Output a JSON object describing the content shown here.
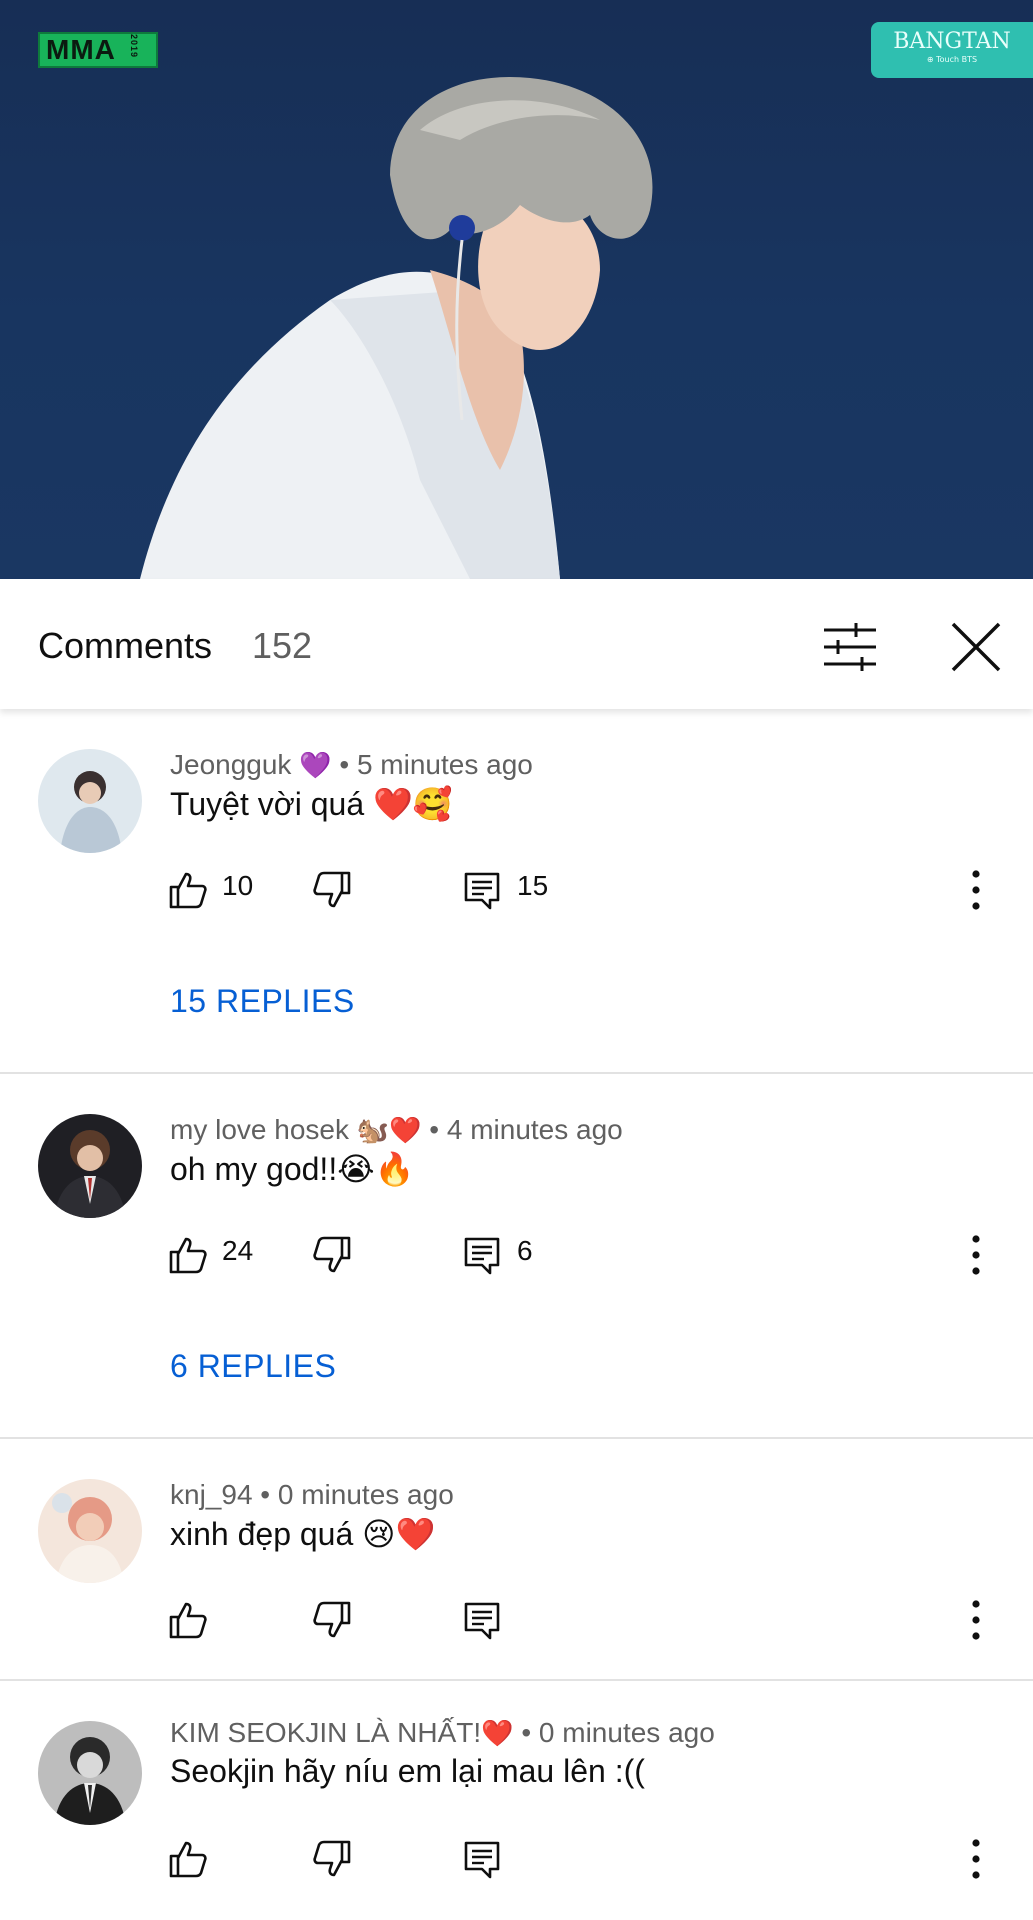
{
  "video": {
    "logo_text": "MMA",
    "logo_year": "2019",
    "channel_badge": "BANGTAN",
    "channel_badge_sub": "⊕ Touch BTS"
  },
  "comments_header": {
    "title": "Comments",
    "count": "152",
    "filter_icon": "sliders-icon",
    "close_icon": "close-icon"
  },
  "comments": [
    {
      "author": "Jeongguk",
      "author_emoji": "💜",
      "time": "• 5 minutes ago",
      "text": "Tuyệt vời quá ❤️🥰",
      "likes": "10",
      "replies": "15",
      "replies_link": "15 REPLIES"
    },
    {
      "author": "my love hosek",
      "author_emoji": "🐿️❤️",
      "time": "• 4 minutes ago",
      "text": "oh my god!!😭🔥",
      "likes": "24",
      "replies": "6",
      "replies_link": "6 REPLIES"
    },
    {
      "author": "knj_94",
      "author_emoji": "",
      "time": "• 0 minutes ago",
      "text": "xinh đẹp quá 😢❤️",
      "likes": "",
      "replies": "",
      "replies_link": ""
    },
    {
      "author": "KIM SEOKJIN LÀ NHẤT!",
      "author_emoji": "❤️",
      "time": "• 0 minutes ago",
      "text": "Seokjin hãy níu em lại mau lên :((",
      "likes": "",
      "replies": "",
      "replies_link": ""
    }
  ],
  "colors": {
    "link_blue": "#065fd4",
    "secondary_text": "#606060",
    "divider": "#e2e2e2",
    "video_bg": "#183560",
    "badge_teal": "#2fbfb0",
    "logo_green": "#18b35a"
  }
}
